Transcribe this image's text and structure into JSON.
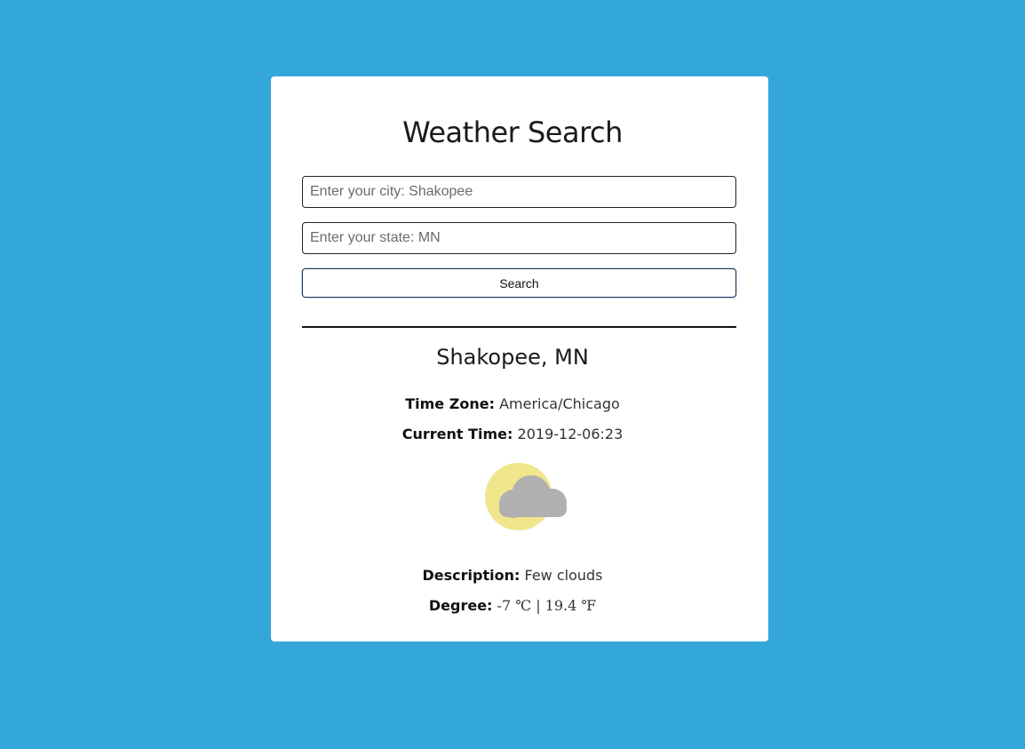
{
  "app": {
    "title": "Weather Search"
  },
  "search": {
    "city_placeholder": "Enter your city: Shakopee",
    "state_placeholder": "Enter your state: MN",
    "button_label": "Search"
  },
  "result": {
    "location": "Shakopee, MN",
    "timezone_label": "Time Zone:",
    "timezone_value": "America/Chicago",
    "current_time_label": "Current Time:",
    "current_time_value": "2019-12-06:23",
    "icon": "few-clouds-icon",
    "description_label": "Description:",
    "description_value": "Few clouds",
    "degree_label": "Degree:",
    "degree_value": "-7 ℃ | 19.4 ℉"
  },
  "colors": {
    "background": "#34a7da",
    "card": "#ffffff",
    "sun": "#f0e68c",
    "cloud": "#b0b0b0"
  }
}
